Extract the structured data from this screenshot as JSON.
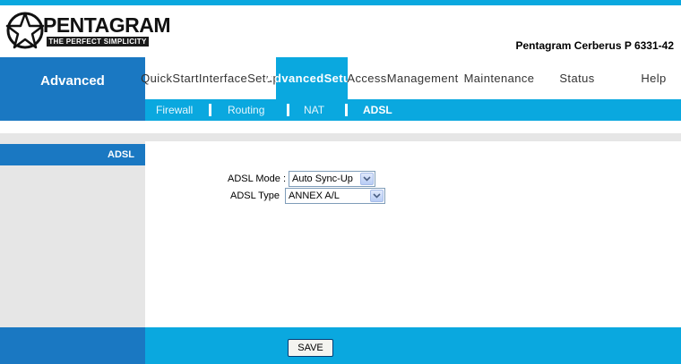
{
  "brand": {
    "name": "PENTAGRAM",
    "tagline": "THE PERFECT SIMPLICITY",
    "model": "Pentagram Cerberus P 6331-42"
  },
  "nav": {
    "section_label": "Advanced",
    "tabs": [
      {
        "label": "Quick Start",
        "active": false
      },
      {
        "label": "Interface Setup",
        "active": false
      },
      {
        "label": "Advanced Setup",
        "active": true
      },
      {
        "label": "Access Management",
        "active": false
      },
      {
        "label": "Maintenance",
        "active": false
      },
      {
        "label": "Status",
        "active": false
      },
      {
        "label": "Help",
        "active": false
      }
    ]
  },
  "subnav": {
    "items": [
      {
        "label": "Firewall",
        "active": false
      },
      {
        "label": "Routing",
        "active": false
      },
      {
        "label": "NAT",
        "active": false
      },
      {
        "label": "ADSL",
        "active": true
      }
    ]
  },
  "sidebar": {
    "title": "ADSL"
  },
  "form": {
    "mode_label": "ADSL Mode :",
    "mode_value": "Auto Sync-Up",
    "type_label": "ADSL Type",
    "type_value": "ANNEX A/L"
  },
  "footer": {
    "save_label": "SAVE"
  },
  "colors": {
    "accent": "#0aa8df",
    "dark_blue": "#1a78c2",
    "panel_grey": "#e6e6e6"
  }
}
